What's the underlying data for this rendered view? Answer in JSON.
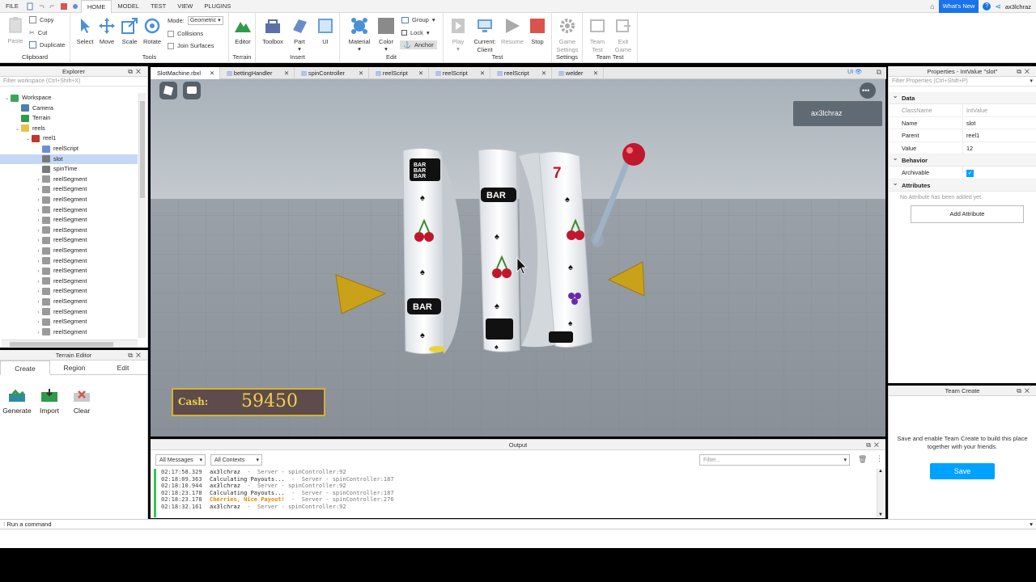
{
  "menu": {
    "file": "FILE",
    "tabs": [
      "HOME",
      "MODEL",
      "TEST",
      "VIEW",
      "PLUGINS"
    ],
    "whats_new": "What's New",
    "user": "ax3lchraz"
  },
  "ribbon": {
    "clipboard": {
      "paste": "Paste",
      "copy": "Copy",
      "cut": "Cut",
      "duplicate": "Duplicate",
      "label": "Clipboard"
    },
    "tools": {
      "select": "Select",
      "move": "Move",
      "scale": "Scale",
      "rotate": "Rotate",
      "mode_label": "Mode:",
      "mode_value": "Geometric",
      "collisions": "Collisions",
      "join_surfaces": "Join Surfaces",
      "label": "Tools"
    },
    "terrain": {
      "editor": "Editor",
      "label": "Terrain"
    },
    "insert": {
      "toolbox": "Toolbox",
      "part": "Part",
      "ui": "UI",
      "label": "Insert"
    },
    "edit": {
      "material": "Material",
      "color": "Color",
      "group": "Group",
      "lock": "Lock",
      "anchor": "Anchor",
      "label": "Edit"
    },
    "test": {
      "play": "Play",
      "current_client": "Current:\nClient",
      "resume": "Resume",
      "stop": "Stop",
      "label": "Test"
    },
    "settings": {
      "game_settings": "Game\nSettings",
      "label": "Settings"
    },
    "team_test": {
      "team_test": "Team\nTest",
      "exit_game": "Exit\nGame",
      "label": "Team Test"
    }
  },
  "explorer": {
    "title": "Explorer",
    "filter_placeholder": "Filter workspace (Ctrl+Shift+X)",
    "items": [
      {
        "label": "Workspace",
        "indent": 0,
        "arrow": "v",
        "icon": "workspace-icon",
        "color": "#3aa65a"
      },
      {
        "label": "Camera",
        "indent": 1,
        "arrow": "",
        "icon": "camera-icon",
        "color": "#4a7fb0"
      },
      {
        "label": "Terrain",
        "indent": 1,
        "arrow": "",
        "icon": "terrain-icon",
        "color": "#2f9a4a"
      },
      {
        "label": "reels",
        "indent": 1,
        "arrow": "v",
        "icon": "folder-icon",
        "color": "#e8c24a"
      },
      {
        "label": "reel1",
        "indent": 2,
        "arrow": "v",
        "icon": "model-icon",
        "color": "#c0392b"
      },
      {
        "label": "reelScript",
        "indent": 3,
        "arrow": "",
        "icon": "script-icon",
        "color": "#6b8fd6"
      },
      {
        "label": "slot",
        "indent": 3,
        "arrow": "",
        "icon": "value-icon",
        "color": "#7a7a7a",
        "selected": true
      },
      {
        "label": "spinTime",
        "indent": 3,
        "arrow": "",
        "icon": "value-icon",
        "color": "#7a7a7a"
      },
      {
        "label": "reelSegment",
        "indent": 3,
        "arrow": ">",
        "icon": "part-icon",
        "color": "#9a9a9a"
      },
      {
        "label": "reelSegment",
        "indent": 3,
        "arrow": ">",
        "icon": "part-icon",
        "color": "#9a9a9a"
      },
      {
        "label": "reelSegment",
        "indent": 3,
        "arrow": ">",
        "icon": "part-icon",
        "color": "#9a9a9a"
      },
      {
        "label": "reelSegment",
        "indent": 3,
        "arrow": ">",
        "icon": "part-icon",
        "color": "#9a9a9a"
      },
      {
        "label": "reelSegment",
        "indent": 3,
        "arrow": ">",
        "icon": "part-icon",
        "color": "#9a9a9a"
      },
      {
        "label": "reelSegment",
        "indent": 3,
        "arrow": ">",
        "icon": "part-icon",
        "color": "#9a9a9a"
      },
      {
        "label": "reelSegment",
        "indent": 3,
        "arrow": ">",
        "icon": "part-icon",
        "color": "#9a9a9a"
      },
      {
        "label": "reelSegment",
        "indent": 3,
        "arrow": ">",
        "icon": "part-icon",
        "color": "#9a9a9a"
      },
      {
        "label": "reelSegment",
        "indent": 3,
        "arrow": ">",
        "icon": "part-icon",
        "color": "#9a9a9a"
      },
      {
        "label": "reelSegment",
        "indent": 3,
        "arrow": ">",
        "icon": "part-icon",
        "color": "#9a9a9a"
      },
      {
        "label": "reelSegment",
        "indent": 3,
        "arrow": ">",
        "icon": "part-icon",
        "color": "#9a9a9a"
      },
      {
        "label": "reelSegment",
        "indent": 3,
        "arrow": ">",
        "icon": "part-icon",
        "color": "#9a9a9a"
      },
      {
        "label": "reelSegment",
        "indent": 3,
        "arrow": ">",
        "icon": "part-icon",
        "color": "#9a9a9a"
      },
      {
        "label": "reelSegment",
        "indent": 3,
        "arrow": ">",
        "icon": "part-icon",
        "color": "#9a9a9a"
      },
      {
        "label": "reelSegment",
        "indent": 3,
        "arrow": ">",
        "icon": "part-icon",
        "color": "#9a9a9a"
      },
      {
        "label": "reelSegment",
        "indent": 3,
        "arrow": ">",
        "icon": "part-icon",
        "color": "#9a9a9a"
      }
    ]
  },
  "terrain_editor": {
    "title": "Terrain Editor",
    "tabs": [
      "Create",
      "Region",
      "Edit"
    ],
    "tools": [
      "Generate",
      "Import",
      "Clear"
    ]
  },
  "doc_tabs": [
    "SlotMachine.rbxl",
    "bettingHandler",
    "spinController",
    "reelScript",
    "reelScript",
    "reelScript",
    "welder"
  ],
  "viewport": {
    "player_name": "ax3lchraz",
    "cash_label": "Cash:",
    "cash_value": "59450",
    "reel_symbols": [
      "BAR",
      "7"
    ]
  },
  "output": {
    "title": "Output",
    "filter_messages": "All Messages",
    "filter_contexts": "All Contexts",
    "filter_placeholder": "Filter...",
    "lines": [
      {
        "ts": "02:17:58.329",
        "msg": "ax3lchraz",
        "src": "  -  Server - spinController:92",
        "warn": false
      },
      {
        "ts": "02:18:09.363",
        "msg": "Calculating Payouts...",
        "src": "  -  Server - spinController:187",
        "warn": false
      },
      {
        "ts": "02:18:10.944",
        "msg": "ax3lchraz",
        "src": "  -  Server - spinController:92",
        "warn": false
      },
      {
        "ts": "02:18:23.178",
        "msg": "Calculating Payouts...",
        "src": "  -  Server - spinController:187",
        "warn": false
      },
      {
        "ts": "02:18:23.178",
        "msg": "Cherries, Nice Payout!",
        "src": "  -  Server - spinController:276",
        "warn": true
      },
      {
        "ts": "02:18:32.161",
        "msg": "ax3lchraz",
        "src": "  -  Server - spinController:92",
        "warn": false
      }
    ]
  },
  "properties": {
    "title": "Properties - IntValue \"slot\"",
    "filter_placeholder": "Filter Properties (Ctrl+Shift+P)",
    "data_section": "Data",
    "rows": [
      {
        "k": "ClassName",
        "v": "IntValue",
        "dim": true
      },
      {
        "k": "Name",
        "v": "slot",
        "dim": false
      },
      {
        "k": "Parent",
        "v": "reel1",
        "dim": false
      },
      {
        "k": "Value",
        "v": "12",
        "dim": false
      }
    ],
    "behavior_section": "Behavior",
    "archivable": "Archivable",
    "attributes_section": "Attributes",
    "no_attribute": "No Attribute has been added yet",
    "add_attribute": "Add Attribute"
  },
  "team_create": {
    "title": "Team Create",
    "message": "Save and enable Team Create to build this place together with your friends.",
    "save": "Save"
  },
  "command_bar": {
    "placeholder": "Run a command"
  },
  "colors": {
    "accent": "#00a2ff",
    "selection": "#c4d8f4",
    "output_bar": "#37c35b",
    "warn": "#e08a00"
  }
}
